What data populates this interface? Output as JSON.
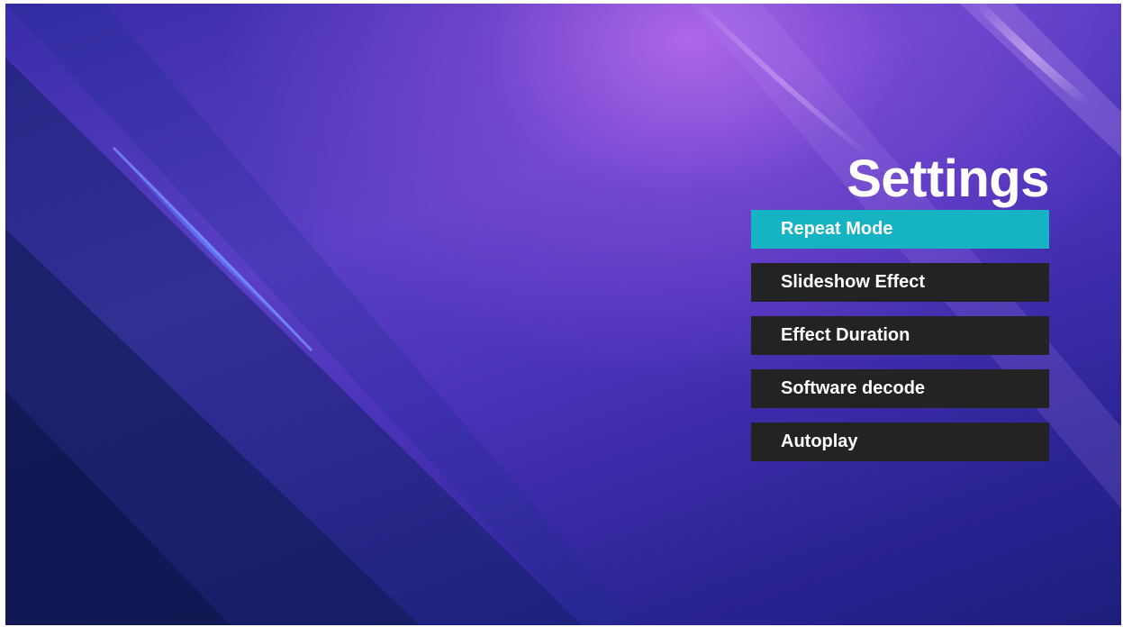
{
  "page": {
    "title": "Settings"
  },
  "menu": {
    "focused_index": 0,
    "items": [
      {
        "label": "Repeat Mode",
        "focused": true
      },
      {
        "label": "Slideshow Effect",
        "focused": false
      },
      {
        "label": "Effect Duration",
        "focused": false
      },
      {
        "label": "Software decode",
        "focused": false
      },
      {
        "label": "Autoplay",
        "focused": false
      }
    ]
  },
  "colors": {
    "focus_highlight": "#16b3c2",
    "item_background": "#232323",
    "text": "#ffffff"
  }
}
